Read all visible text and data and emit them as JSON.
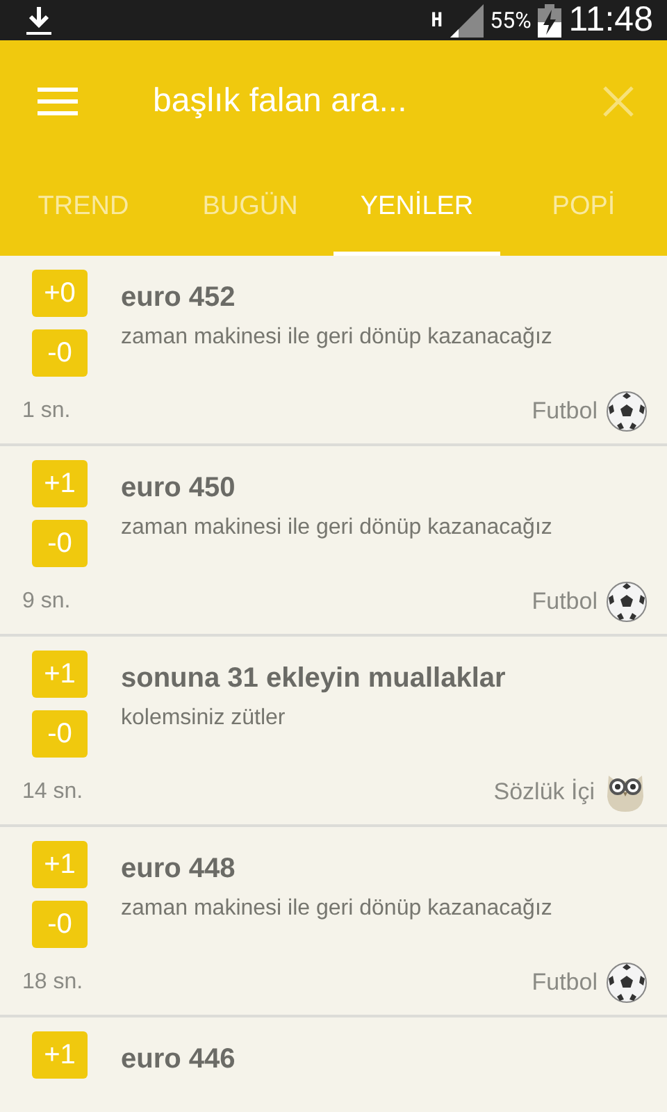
{
  "status_bar": {
    "network": "H",
    "battery": "55%",
    "time": "11:48"
  },
  "toolbar": {
    "search_placeholder": "başlık falan ara..."
  },
  "tabs": [
    {
      "label": "TREND",
      "selected": false
    },
    {
      "label": "BUGÜN",
      "selected": false
    },
    {
      "label": "YENİLER",
      "selected": true
    },
    {
      "label": "POPİ",
      "selected": false
    }
  ],
  "entries": [
    {
      "up": "+0",
      "down": "-0",
      "title": "euro 452",
      "subtitle": "zaman makinesi ile geri dönüp kazanacağız",
      "age": "1 sn.",
      "category": "Futbol",
      "kind": "ball"
    },
    {
      "up": "+1",
      "down": "-0",
      "title": "euro 450",
      "subtitle": "zaman makinesi ile geri dönüp kazanacağız",
      "age": "9 sn.",
      "category": "Futbol",
      "kind": "ball"
    },
    {
      "up": "+1",
      "down": "-0",
      "title": "sonuna 31 ekleyin muallaklar",
      "subtitle": "kolemsiniz zütler",
      "age": "14 sn.",
      "category": "Sözlük İçi",
      "kind": "owl"
    },
    {
      "up": "+1",
      "down": "-0",
      "title": "euro 448",
      "subtitle": "zaman makinesi ile geri dönüp kazanacağız",
      "age": "18 sn.",
      "category": "Futbol",
      "kind": "ball"
    },
    {
      "up": "+1",
      "title": "euro 446"
    }
  ]
}
